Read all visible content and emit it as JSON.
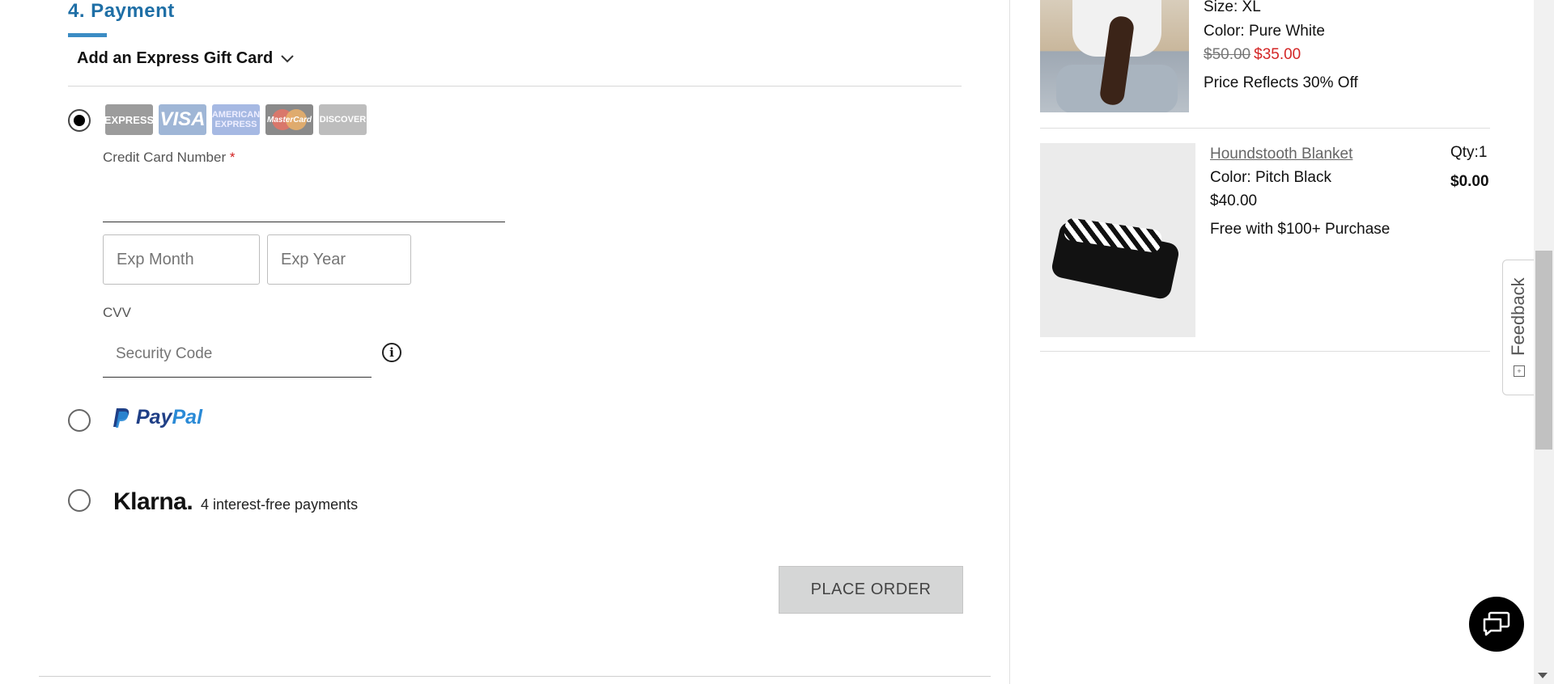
{
  "payment": {
    "section_title": "4. Payment",
    "gift_card_toggle": "Add an Express Gift Card",
    "card_logos": [
      "EXPRESS",
      "VISA",
      "AMERICAN EXPRESS",
      "MasterCard",
      "DISCOVER"
    ],
    "credit_card_label": "Credit Card Number",
    "required_mark": "*",
    "exp_month_placeholder": "Exp Month",
    "exp_year_placeholder": "Exp Year",
    "cvv_label": "CVV",
    "cvv_placeholder": "Security Code",
    "info_glyph": "i",
    "paypal_text_1": "Pay",
    "paypal_text_2": "Pal",
    "klarna_logo": "Klarna.",
    "klarna_text": "4 interest-free payments",
    "place_order_label": "PLACE ORDER",
    "selected_method": "credit-card"
  },
  "cart": {
    "item1": {
      "size": "Size: XL",
      "color": "Color: Pure White",
      "old_price": "$50.00",
      "new_price": "$35.00",
      "promo": "Price Reflects 30% Off"
    },
    "item2": {
      "name": "Houndstooth Blanket",
      "color": "Color: Pitch Black",
      "price": "$40.00",
      "promo": "Free with $100+ Purchase",
      "qty": "Qty:1",
      "total": "$0.00"
    }
  },
  "feedback": {
    "label": "Feedback"
  },
  "colors": {
    "accent": "#1f6fa6",
    "sale_red": "#d32626",
    "button_gray": "#d5d6d6"
  },
  "icons": {
    "gift_chevron": "chevron-down-icon",
    "info": "info-icon",
    "chat": "chat-icon"
  }
}
